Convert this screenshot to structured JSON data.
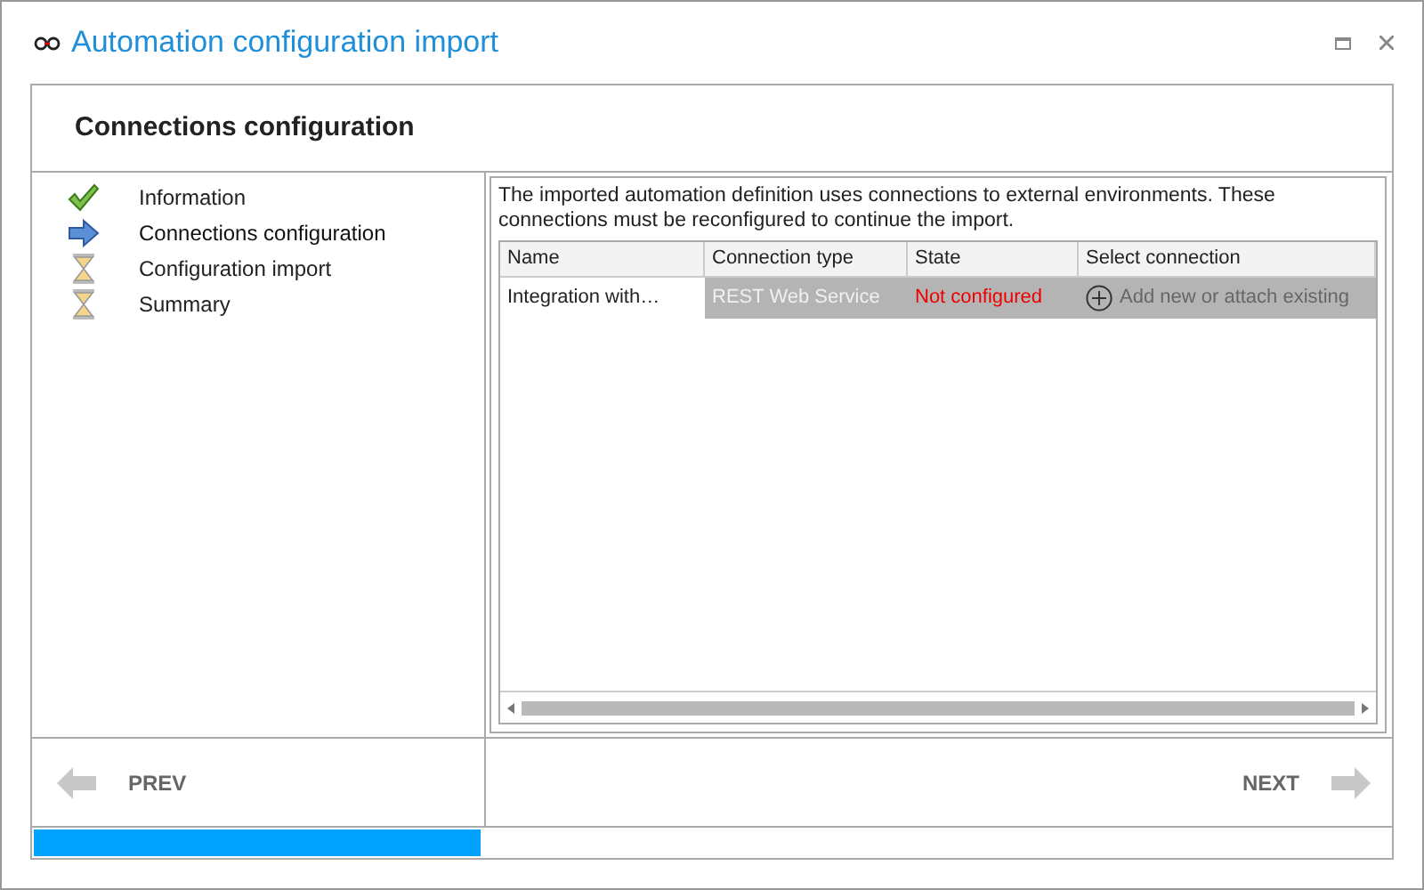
{
  "window": {
    "title": "Automation configuration import"
  },
  "header": {
    "title": "Connections configuration"
  },
  "steps": [
    {
      "label": "Information",
      "kind": "done"
    },
    {
      "label": "Connections configuration",
      "kind": "current"
    },
    {
      "label": "Configuration import",
      "kind": "pending"
    },
    {
      "label": "Summary",
      "kind": "pending"
    }
  ],
  "description": "The imported automation definition uses connections to external environments. These connections must be reconfigured to continue the import.",
  "table": {
    "columns": [
      "Name",
      "Connection type",
      "State",
      "Select connection"
    ],
    "rows": [
      {
        "name": "Integration with…",
        "connection_type": "REST Web Service",
        "state": "Not configured",
        "configured": false,
        "select_connection": "Add new or attach existing",
        "selected": true
      }
    ]
  },
  "footer": {
    "prev": "PREV",
    "next": "NEXT"
  },
  "progress": {
    "level": 0.33
  }
}
